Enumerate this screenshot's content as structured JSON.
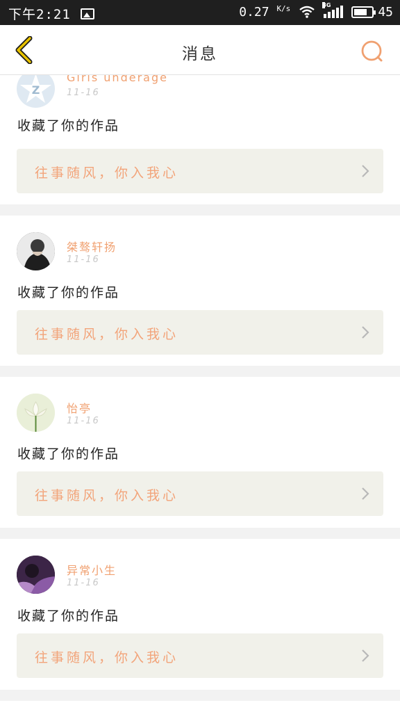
{
  "status_bar": {
    "time": "下午2:21",
    "speed": "0.27",
    "speed_unit": "K/s",
    "network": "3G",
    "battery": "45"
  },
  "header": {
    "title": "消息"
  },
  "messages": [
    {
      "username": "Girls underage",
      "date": "11-16",
      "action": "收藏了你的作品",
      "work_title": "往事随风，你入我心"
    },
    {
      "username": "桀骜轩扬",
      "date": "11-16",
      "action": "收藏了你的作品",
      "work_title": "往事随风，你入我心"
    },
    {
      "username": "怡亭",
      "date": "11-16",
      "action": "收藏了你的作品",
      "work_title": "往事随风，你入我心"
    },
    {
      "username": "异常小生",
      "date": "11-16",
      "action": "收藏了你的作品",
      "work_title": "往事随风，你入我心"
    }
  ],
  "colors": {
    "accent": "#f0a070",
    "back_arrow": "#e8c200",
    "search": "#f0a070"
  },
  "icons": {
    "back": "chevron-left-icon",
    "search": "search-icon",
    "row_arrow": "chevron-right-icon"
  }
}
